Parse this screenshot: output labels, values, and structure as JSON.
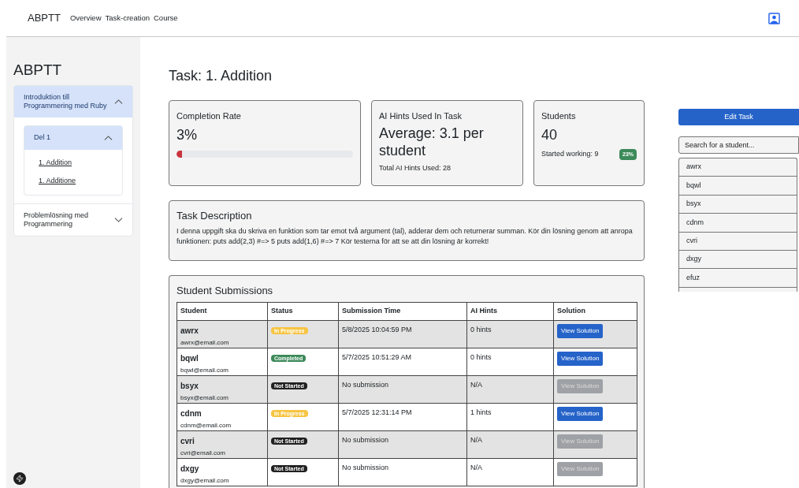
{
  "navbar": {
    "brand": "ABPTT",
    "links": [
      "Overview",
      "Task-creation",
      "Course"
    ]
  },
  "sidebar": {
    "title": "ABPTT",
    "sections": [
      {
        "label": "Introduktion till Programmering med Ruby",
        "expanded": true,
        "children": [
          {
            "label": "Del 1",
            "expanded": true,
            "children": [
              {
                "label": "1. Addition"
              },
              {
                "label": "1. Additione"
              }
            ]
          }
        ]
      },
      {
        "label": "Problemlösning med Programmering",
        "expanded": false
      }
    ]
  },
  "page_title": "Task: 1. Addition",
  "stats": {
    "completion": {
      "title": "Completion Rate",
      "value": "3%",
      "level": 0.03
    },
    "hints": {
      "title": "AI Hints Used In Task",
      "value": "Average: 3.1 per student",
      "total": "Total AI Hints Used: 28"
    },
    "students": {
      "title": "Students",
      "value": "40",
      "started": "Started working: 9",
      "badge": "23%"
    }
  },
  "description": {
    "title": "Task Description",
    "text": "I denna uppgift ska du skriva en funktion som tar emot två argument (tal), adderar dem och returnerar summan. Kör din lösning genom att anropa funktionen: puts add(2,3) #=> 5 puts add(1,6) #=> 7 Kör testerna för att se att din lösning är korrekt!"
  },
  "submissions": {
    "title": "Student Submissions",
    "columns": [
      "Student",
      "Status",
      "Submission Time",
      "AI Hints",
      "Solution"
    ],
    "rows": [
      {
        "name": "awrx",
        "email": "awrx@email.com",
        "status": "In Progress",
        "kind": "in_progress",
        "time": "5/8/2025 10:04:59 PM",
        "hints": "0 hints",
        "solution": "View Solution",
        "disabled": false
      },
      {
        "name": "bqwl",
        "email": "bqwl@email.com",
        "status": "Completed",
        "kind": "completed",
        "time": "5/7/2025 10:51:29 AM",
        "hints": "0 hints",
        "solution": "View Solution",
        "disabled": false
      },
      {
        "name": "bsyx",
        "email": "bsyx@email.com",
        "status": "Not Started",
        "kind": "not_started",
        "time": "No submission",
        "hints": "N/A",
        "solution": "View Solution",
        "disabled": true
      },
      {
        "name": "cdnm",
        "email": "cdnm@email.com",
        "status": "In Progress",
        "kind": "in_progress",
        "time": "5/7/2025 12:31:14 PM",
        "hints": "1 hints",
        "solution": "View Solution",
        "disabled": false
      },
      {
        "name": "cvri",
        "email": "cvri@email.com",
        "status": "Not Started",
        "kind": "not_started",
        "time": "No submission",
        "hints": "N/A",
        "solution": "View Solution",
        "disabled": true
      },
      {
        "name": "dxgy",
        "email": "dxgy@email.com",
        "status": "Not Started",
        "kind": "not_started",
        "time": "No submission",
        "hints": "N/A",
        "solution": "View Solution",
        "disabled": true
      }
    ]
  },
  "right_panel": {
    "edit_button": "Edit Task",
    "search": {
      "placeholder": "Search for a student..."
    },
    "students": [
      "awrx",
      "bqwl",
      "bsyx",
      "cdnm",
      "cvri",
      "dxgy",
      "efuz"
    ]
  }
}
